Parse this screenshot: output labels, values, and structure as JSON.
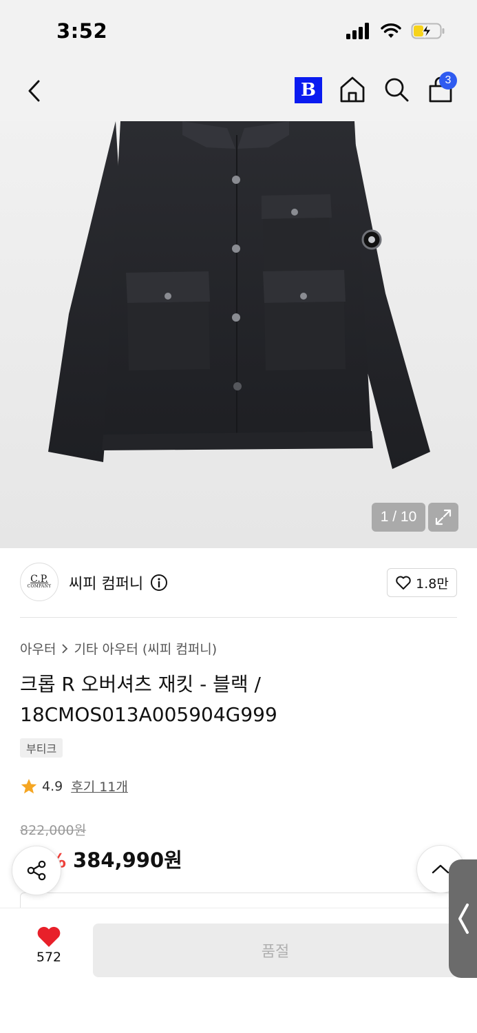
{
  "status_bar": {
    "time": "3:52"
  },
  "header": {
    "brand_badge": "B",
    "cart_count": "3"
  },
  "gallery": {
    "counter": "1 / 10"
  },
  "brand": {
    "logo_big": "C.P.",
    "logo_small": "COMPANY",
    "name": "씨피 컴퍼니",
    "like_count": "1.8만"
  },
  "breadcrumb": {
    "category": "아우터",
    "subcategory": "기타 아우터 (씨피 컴퍼니)"
  },
  "product": {
    "title": "크롭 R 오버셔츠 재킷 - 블랙 / 18CMOS013A005904G999",
    "tag": "부티크",
    "rating": "4.9",
    "review_link": "후기 11개",
    "original_price": "822,000원",
    "discount": "53%",
    "sale_price": "384,990원"
  },
  "bottom": {
    "wish_count": "572",
    "soldout_label": "품절"
  },
  "colors": {
    "accent_blue": "#2f5bf0",
    "brand_b": "#0a1bf0",
    "discount_red": "#f0413b",
    "heart_red": "#e8202a",
    "star": "#f5a623"
  },
  "icons": [
    "back-arrow-icon",
    "home-icon",
    "search-icon",
    "cart-icon",
    "expand-icon",
    "info-icon",
    "heart-outline-icon",
    "star-icon",
    "share-icon",
    "chevron-up-icon",
    "heart-filled-icon",
    "chevron-left-icon"
  ]
}
